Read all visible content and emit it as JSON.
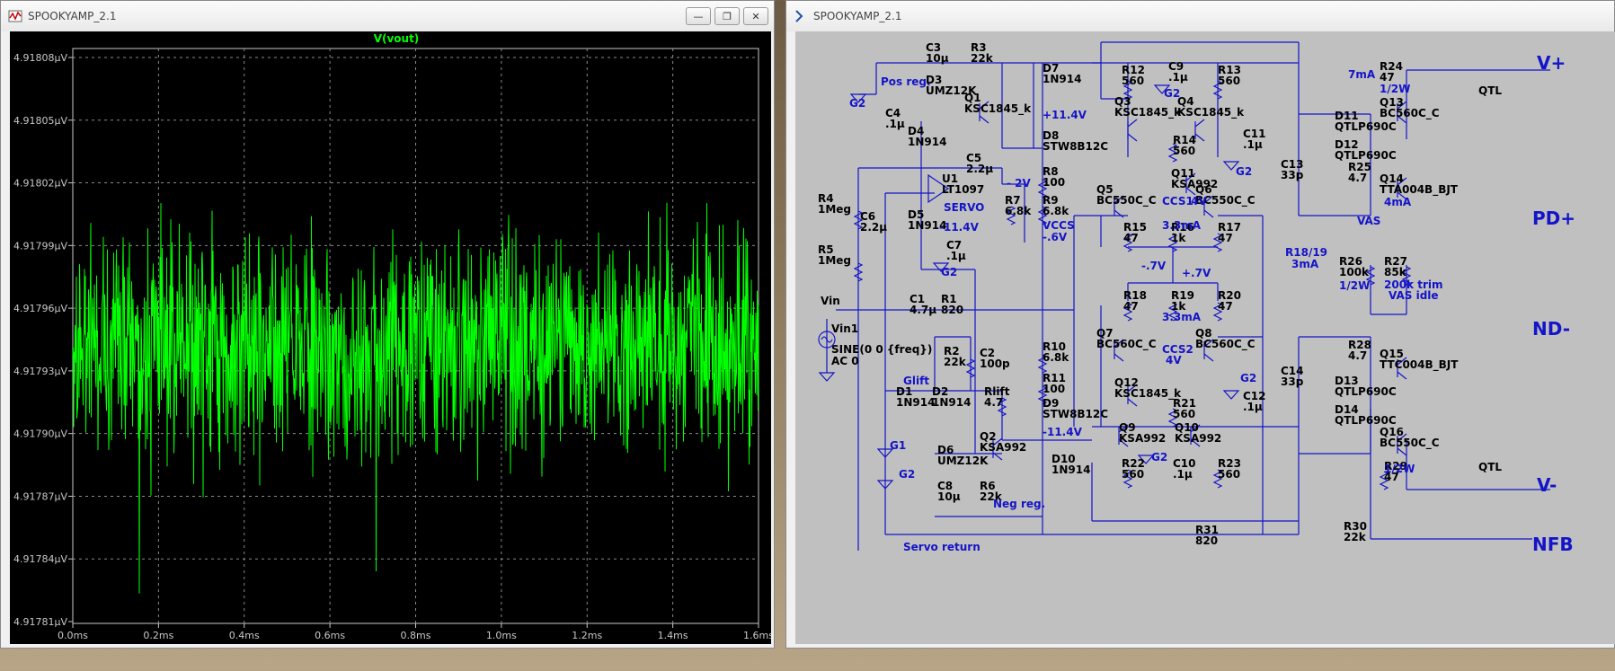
{
  "waveform_window": {
    "title": "SPOOKYAMP_2.1",
    "trace_label": "V(vout)",
    "y_ticks": [
      "4.91808µV",
      "4.91805µV",
      "4.91802µV",
      "4.91799µV",
      "4.91796µV",
      "4.91793µV",
      "4.91790µV",
      "4.91787µV",
      "4.91784µV",
      "4.91781µV"
    ],
    "x_ticks": [
      "0.0ms",
      "0.2ms",
      "0.4ms",
      "0.6ms",
      "0.8ms",
      "1.0ms",
      "1.2ms",
      "1.4ms",
      "1.6ms"
    ],
    "trace_color": "#00ff00"
  },
  "schematic_window": {
    "title": "SPOOKYAMP_2.1",
    "parts": [
      [
        "C3",
        "10µ"
      ],
      [
        "R3",
        "22k"
      ],
      [
        "D3",
        "UMZ12K"
      ],
      [
        "Q1",
        "KSC1845_k"
      ],
      [
        "C4",
        ".1µ"
      ],
      [
        "D4",
        "1N914"
      ],
      [
        "C5",
        "2.2µ"
      ],
      [
        "U1",
        "LT1097"
      ],
      [
        "R7",
        "6.8k"
      ],
      [
        "D5",
        "1N914"
      ],
      [
        "C6",
        "2.2µ"
      ],
      [
        "C7",
        ".1µ"
      ],
      [
        "R4",
        "1Meg"
      ],
      [
        "R5",
        "1Meg"
      ],
      [
        "D7",
        "1N914"
      ],
      [
        "D8",
        "STW8B12C"
      ],
      [
        "R8",
        "100"
      ],
      [
        "R9",
        "6.8k"
      ],
      [
        "R12",
        "560"
      ],
      [
        "C9",
        ".1µ"
      ],
      [
        "R13",
        "560"
      ],
      [
        "Q3",
        "KSC1845_k"
      ],
      [
        "Q4",
        "KSC1845_k"
      ],
      [
        "R14",
        "560"
      ],
      [
        "C11",
        ".1µ"
      ],
      [
        "Q11",
        "KSA992"
      ],
      [
        "Q5",
        "BC550C_C"
      ],
      [
        "Q6",
        "BC550C_C"
      ],
      [
        "R15",
        "47"
      ],
      [
        "R16",
        "1k"
      ],
      [
        "R17",
        "47"
      ],
      [
        "R18",
        "47"
      ],
      [
        "R19",
        "1k"
      ],
      [
        "R20",
        "47"
      ],
      [
        "Q7",
        "BC560C_C"
      ],
      [
        "Q8",
        "BC560C_C"
      ],
      [
        "Q12",
        "KSC1845_k"
      ],
      [
        "R21",
        "560"
      ],
      [
        "C12",
        ".1µ"
      ],
      [
        "Q9",
        "KSA992"
      ],
      [
        "Q10",
        "KSA992"
      ],
      [
        "R22",
        "560"
      ],
      [
        "C10",
        ".1µ"
      ],
      [
        "R23",
        "560"
      ],
      [
        "C1",
        "4.7µ"
      ],
      [
        "R1",
        "820"
      ],
      [
        "R2",
        "22k"
      ],
      [
        "C2",
        "100p"
      ],
      [
        "D1",
        "1N914"
      ],
      [
        "D2",
        "1N914"
      ],
      [
        "Rlift",
        "4.7"
      ],
      [
        "D6",
        "UMZ12K"
      ],
      [
        "Q2",
        "KSA992"
      ],
      [
        "C8",
        "10µ"
      ],
      [
        "R6",
        "22k"
      ],
      [
        "R10",
        "6.8k"
      ],
      [
        "R11",
        "100"
      ],
      [
        "D9",
        "STW8B12C"
      ],
      [
        "D10",
        "1N914"
      ],
      [
        "R31",
        "820"
      ],
      [
        "R30",
        "22k"
      ],
      [
        "C13",
        "33p"
      ],
      [
        "C14",
        "33p"
      ],
      [
        "R24",
        "47"
      ],
      [
        "Q13",
        "BC560C_C"
      ],
      [
        "D11",
        "QTLP690C"
      ],
      [
        "D12",
        "QTLP690C"
      ],
      [
        "R25",
        "4.7"
      ],
      [
        "Q14",
        "TTA004B_BJT"
      ],
      [
        "R26",
        "100k"
      ],
      [
        "R27",
        "85k"
      ],
      [
        "R28",
        "4.7"
      ],
      [
        "Q15",
        "TTC004B_BJT"
      ],
      [
        "D13",
        "QTLP690C"
      ],
      [
        "D14",
        "QTLP690C"
      ],
      [
        "Q16",
        "BC550C_C"
      ],
      [
        "R29",
        "47"
      ]
    ],
    "source": {
      "name": "Vin1",
      "value": "SINE(0 0 {freq})",
      "ac": "AC 0",
      "net": "Vin"
    },
    "annotations": {
      "pos_reg": "Pos reg.",
      "neg_reg": "Neg reg.",
      "servo": "SERVO",
      "servo_return": "Servo return",
      "v_m2": "- 2V",
      "v_p114": "+11.4V",
      "v_m114a": "-11.4V",
      "v_m114b": "-11.4V",
      "vccs": "VCCS",
      "v_m06": "-.6V",
      "ccs1": "CCS1",
      "v4a": "4V",
      "ma33a": "3.3mA",
      "v_m07": "-.7V",
      "v_p07": "+.7V",
      "ma33b": "3.3mA",
      "ccs2": "CCS2",
      "v4b": "4V",
      "glift": "Glift",
      "g1": "G1",
      "g2a": "G2",
      "g2b": "G2",
      "g2c": "G2",
      "g2d": "G2",
      "g2e": "G2",
      "g2f": "G2",
      "g2g": "G2",
      "ma7": "7mA",
      "w12a": "1/2W",
      "ma4": "4mA",
      "r1819": "R18/19",
      "ma3": "3mA",
      "w12b": "1/2W",
      "trim": "200k trim",
      "vasidle": "VAS idle",
      "w12c": "1/2W",
      "qtl1": "QTL",
      "qtl2": "QTL",
      "vplus": "V+",
      "vas": "VAS",
      "pdplus": "PD+",
      "ndminus": "ND-",
      "vminus": "V-",
      "nfb": "NFB"
    }
  }
}
